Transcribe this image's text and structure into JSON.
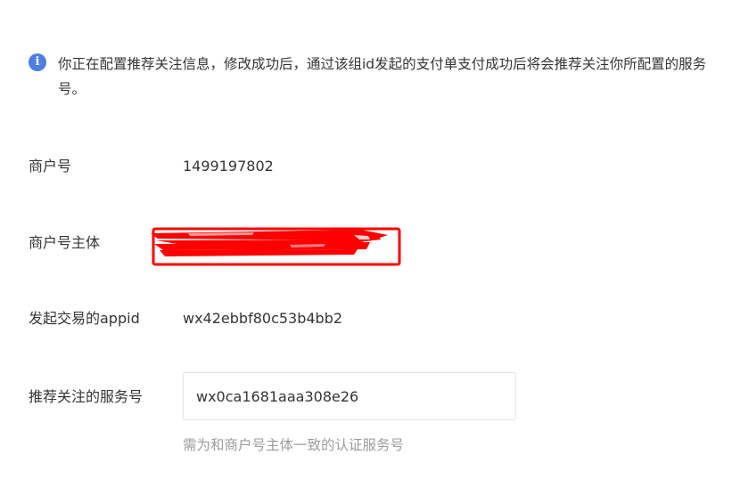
{
  "notice": {
    "icon": "info-icon",
    "icon_glyph": "i",
    "text": "你正在配置推荐关注信息，修改成功后，通过该组id发起的支付单支付成功后将会推荐关注你所配置的服务号。"
  },
  "fields": {
    "merchant_id": {
      "label": "商户号",
      "value": "1499197802"
    },
    "merchant_entity": {
      "label": "商户号主体",
      "value_redacted": true
    },
    "appid": {
      "label": "发起交易的appid",
      "value": "wx42ebbf80c53b4bb2"
    },
    "service_account": {
      "label": "推荐关注的服务号",
      "value": "wx0ca1681aaa308e26",
      "hint": "需为和商户号主体一致的认证服务号"
    }
  },
  "colors": {
    "info_icon": "#4d7fe0",
    "redaction": "#ff0000",
    "hint_text": "#9d9d9d"
  }
}
